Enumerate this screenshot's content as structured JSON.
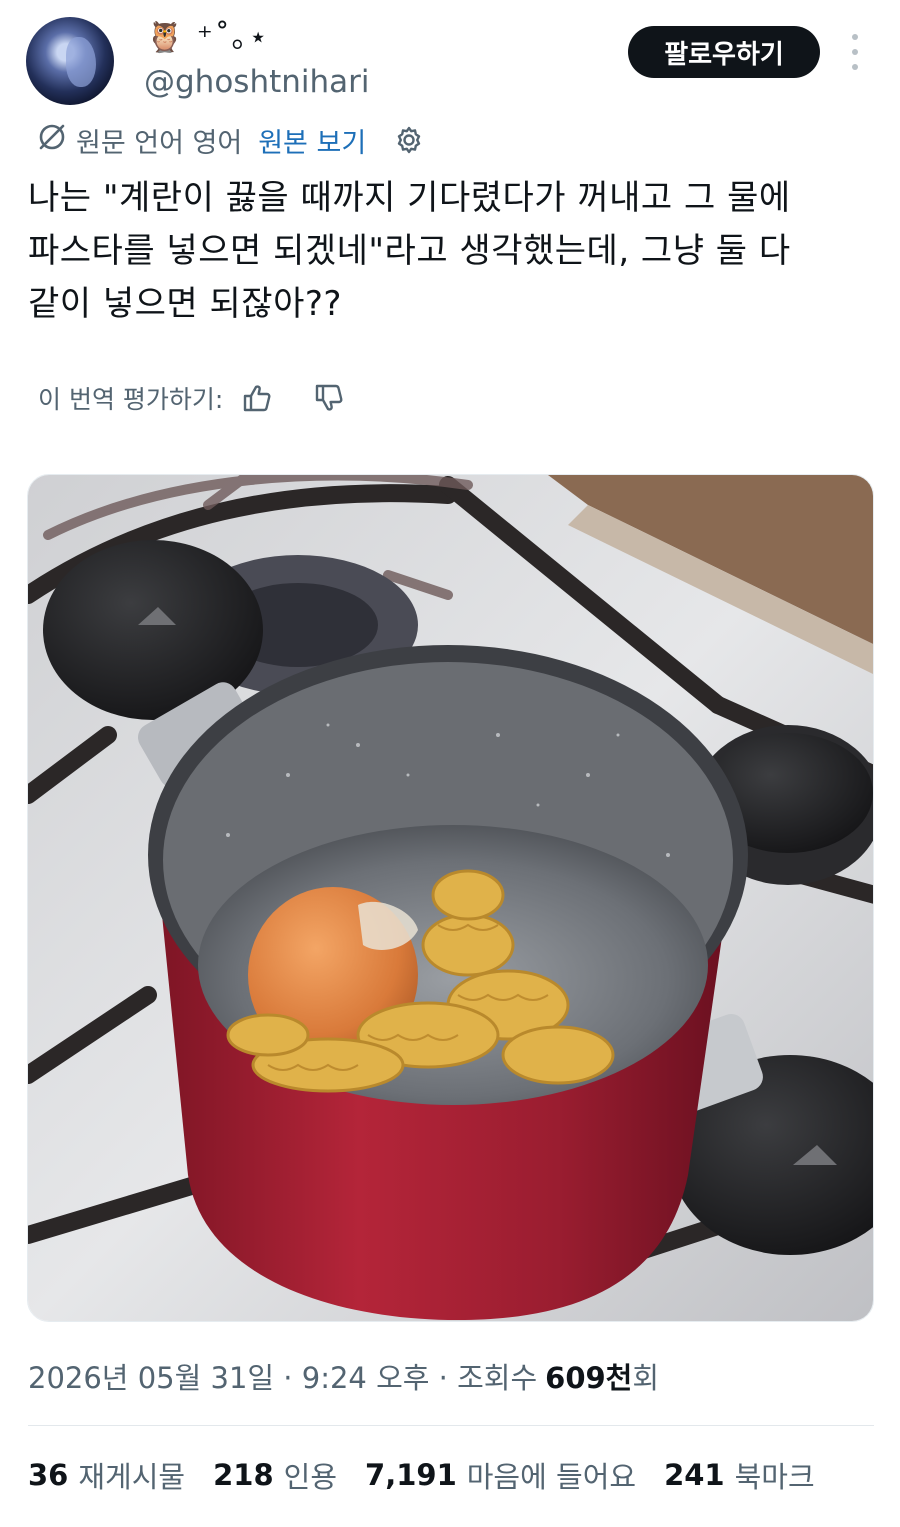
{
  "user": {
    "display_name": "🦉 ⁺˚｡⋆",
    "handle": "@ghoshtnihari",
    "follow_label": "팔로우하기"
  },
  "translation": {
    "language_note": "원문 언어 영어",
    "show_original": "원본 보기",
    "rate_label": "이 번역 평가하기:"
  },
  "tweet": {
    "lines": [
      "나는 \"계란이 끓을 때까지 기다렸다가 꺼내고 그 물에",
      "파스타를 넣으면 되겠네\"라고 생각했는데, 그냥 둘 다",
      "같이 넣으면 되잖아??"
    ]
  },
  "meta": {
    "date_time": "2026년 05월 31일 · 9:24 오후 · 조회수",
    "views": "609천",
    "views_suffix": "회"
  },
  "stats": [
    {
      "num": "36",
      "label": "재게시물"
    },
    {
      "num": "218",
      "label": "인용"
    },
    {
      "num": "7,191",
      "label": "마음에 들어요"
    },
    {
      "num": "241",
      "label": "북마크"
    }
  ],
  "icons": {
    "translate": "no-translate-icon",
    "settings": "gear-icon",
    "thumbs_up": "thumbs-up-icon",
    "thumbs_down": "thumbs-down-icon",
    "more": "more-vertical-icon"
  },
  "colors": {
    "link": "#1d6fb8",
    "secondary_text": "#536471",
    "follow_bg": "#0f1419"
  }
}
